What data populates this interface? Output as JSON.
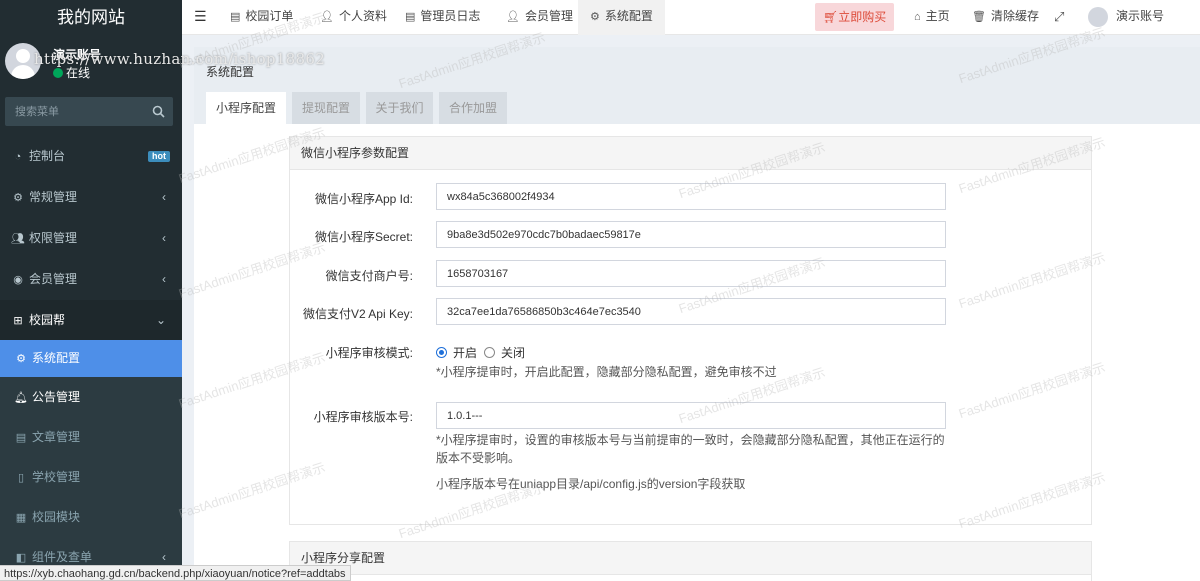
{
  "brand": "我的网站",
  "watermark_url": "https://www.huzhan.com/ishop18862",
  "watermark_text": "FastAdmin应用校园帮演示",
  "user": {
    "name": "演示账号",
    "status": "在线"
  },
  "search": {
    "placeholder": "搜索菜单"
  },
  "menu": {
    "dashboard": {
      "label": "控制台",
      "badge": "hot"
    },
    "general": "常规管理",
    "auth": "权限管理",
    "member": "会员管理",
    "campus": "校园帮",
    "sub": {
      "config": "系统配置",
      "notice": "公告管理",
      "article": "文章管理",
      "school": "学校管理",
      "module": "校园模块",
      "components": "组件及查单"
    }
  },
  "topnav": {
    "tabs": [
      "校园订单",
      "个人资料",
      "管理员日志",
      "会员管理",
      "系统配置"
    ],
    "buy": "立即购买",
    "home": "主页",
    "clear_cache": "清除缓存",
    "account": "演示账号"
  },
  "page": {
    "title": "系统配置",
    "tabs": [
      "小程序配置",
      "提现配置",
      "关于我们",
      "合作加盟"
    ]
  },
  "panel1": {
    "title": "微信小程序参数配置",
    "app_id_label": "微信小程序App Id:",
    "app_id_value": "wx84a5c368002f4934",
    "secret_label": "微信小程序Secret:",
    "secret_value": "9ba8e3d502e970cdc7b0badaec59817e",
    "mch_label": "微信支付商户号:",
    "mch_value": "1658703167",
    "apikey_label": "微信支付V2 Api Key:",
    "apikey_value": "32ca7ee1da76586850b3c464e7ec3540",
    "audit_label": "小程序审核模式:",
    "audit_on": "开启",
    "audit_off": "关闭",
    "audit_help": "*小程序提审时，开启此配置，隐藏部分隐私配置，避免审核不过",
    "version_label": "小程序审核版本号:",
    "version_value": "1.0.1---",
    "version_help": "*小程序提审时，设置的审核版本号与当前提审的一致时，会隐藏部分隐私配置，其他正在运行的版本不受影响。",
    "version_note": "小程序版本号在uniapp目录/api/config.js的version字段获取"
  },
  "panel2": {
    "title": "小程序分享配置"
  },
  "statusbar": "https://xyb.chaohang.gd.cn/backend.php/xiaoyuan/notice?ref=addtabs"
}
